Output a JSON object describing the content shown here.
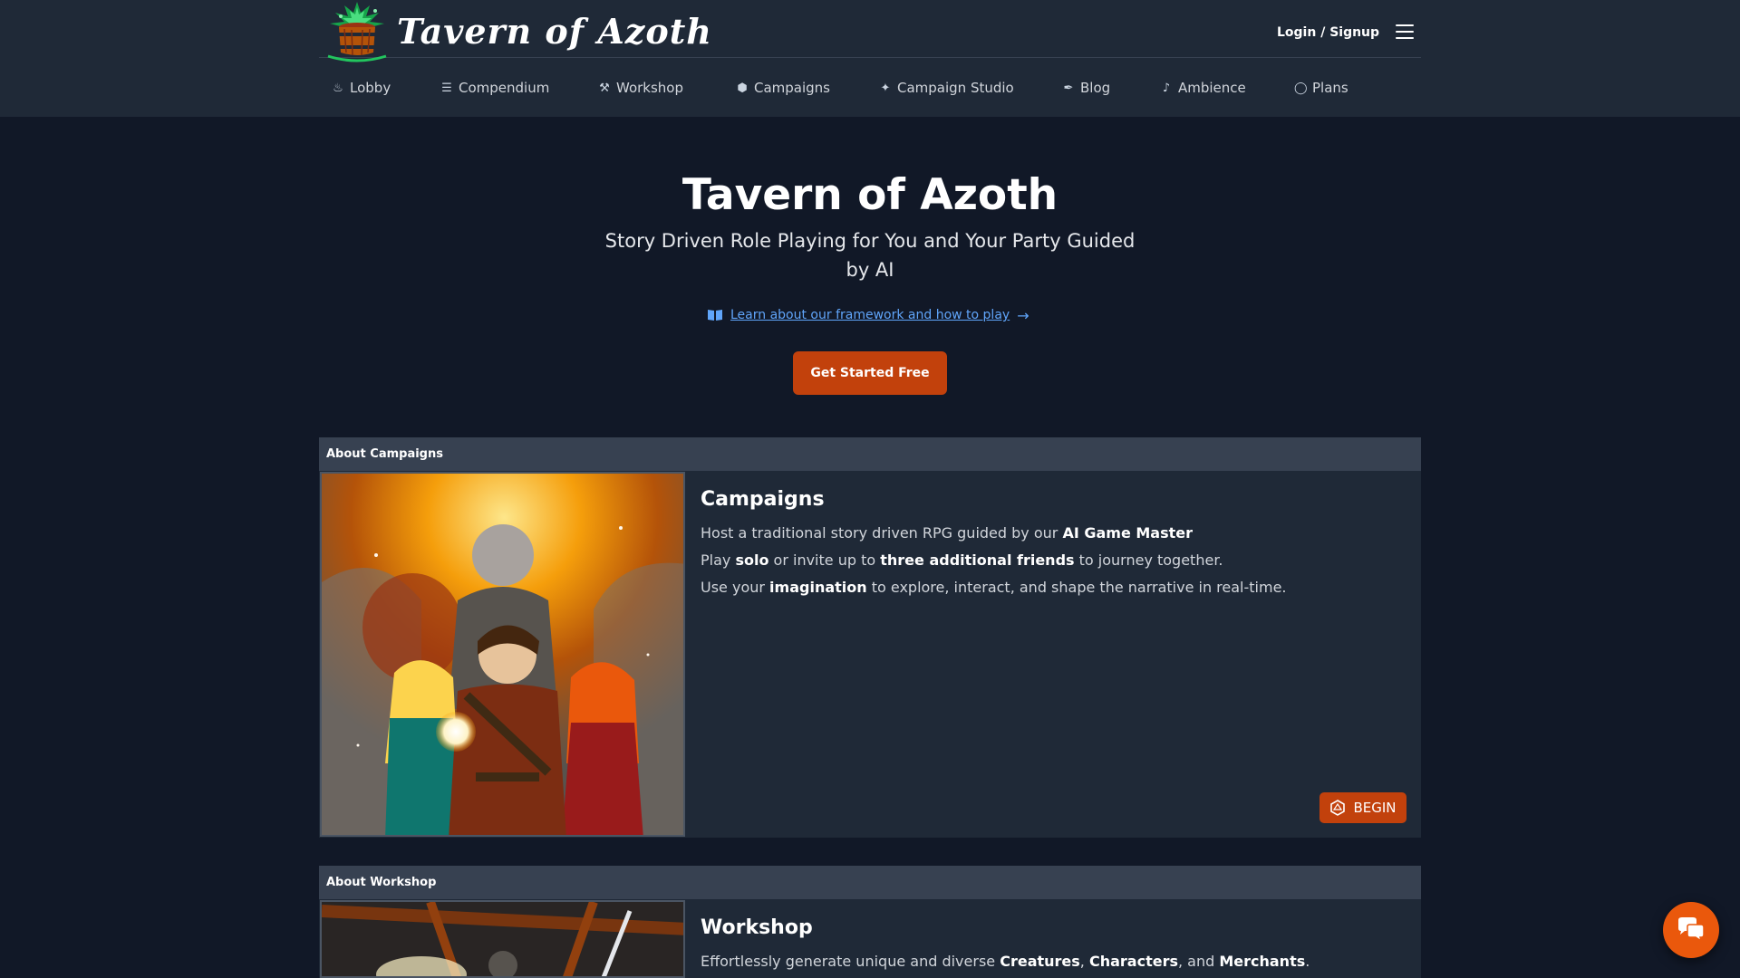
{
  "brand": {
    "name": "Tavern of Azoth"
  },
  "header": {
    "login_label": "Login / Signup"
  },
  "nav": {
    "items": [
      {
        "label": "Lobby",
        "icon": "campfire-icon"
      },
      {
        "label": "Compendium",
        "icon": "books-icon"
      },
      {
        "label": "Workshop",
        "icon": "hammer-icon"
      },
      {
        "label": "Campaigns",
        "icon": "dice-icon"
      },
      {
        "label": "Campaign Studio",
        "icon": "magic-wand-icon"
      },
      {
        "label": "Blog",
        "icon": "feather-icon"
      },
      {
        "label": "Ambience",
        "icon": "music-note-icon"
      },
      {
        "label": "Plans",
        "icon": "coins-icon"
      }
    ]
  },
  "hero": {
    "title": "Tavern of Azoth",
    "subtitle": "Story Driven Role Playing for You and Your Party Guided by AI",
    "learn_link": "Learn about our framework and how to play",
    "cta_label": "Get Started Free"
  },
  "campaigns_section": {
    "header": "About Campaigns",
    "title": "Campaigns",
    "line1": {
      "a": "Host a traditional story driven RPG guided by our ",
      "b": "AI Game Master"
    },
    "line2": {
      "a": "Play ",
      "b": "solo",
      "c": " or invite up to ",
      "d": "three additional friends",
      "e": " to journey together."
    },
    "line3": {
      "a": "Use your ",
      "b": "imagination",
      "c": " to explore, interact, and shape the narrative in real-time."
    },
    "button_label": "BEGIN"
  },
  "workshop_section": {
    "header": "About Workshop",
    "title": "Workshop",
    "line1": {
      "a": "Effortlessly generate unique and diverse ",
      "b": "Creatures",
      "c": ", ",
      "d": "Characters",
      "e": ", and ",
      "f": "Merchants",
      "g": "."
    }
  },
  "colors": {
    "background": "#111827",
    "header": "#1f2937",
    "accent": "#c2410c",
    "link": "#60a5fa"
  }
}
